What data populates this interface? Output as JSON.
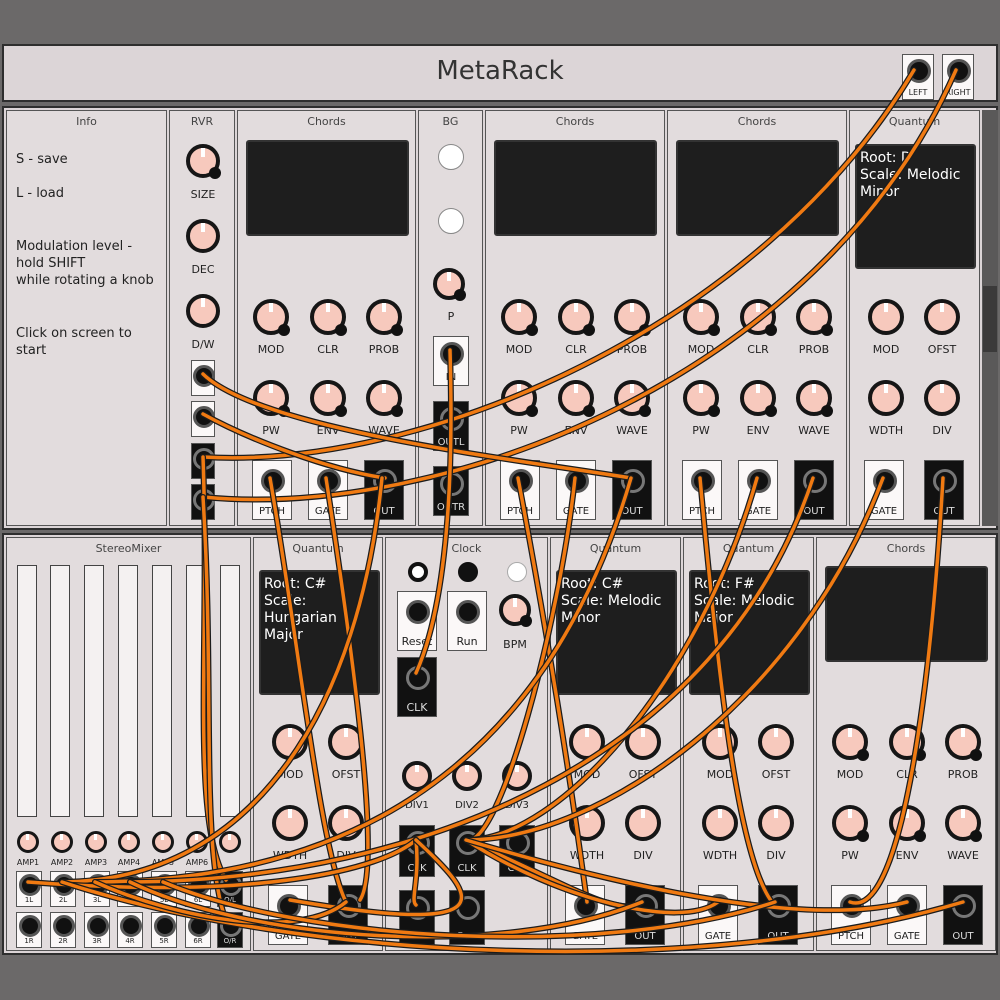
{
  "app": {
    "title": "MetaRack"
  },
  "header": {
    "left_label": "LEFT",
    "right_label": "RIGHT"
  },
  "colors": {
    "cable": "#f07a12",
    "knob": "#f7c9bd",
    "panel": "#e2dcdd",
    "screen": "#1e1e1e"
  },
  "info": {
    "title": "Info",
    "line1": "S - save",
    "line2": "L - load",
    "line3": "Modulation level -\nhold SHIFT\nwhile rotating a knob",
    "line4": "Click on screen to start"
  },
  "rvr": {
    "title": "RVR",
    "size": "SIZE",
    "dec": "DEC",
    "dw": "D/W"
  },
  "bg": {
    "title": "BG",
    "p": "P",
    "in": "IN",
    "outl": "OUTL",
    "outr": "OUTR"
  },
  "chords": {
    "title": "Chords",
    "mod": "MOD",
    "clr": "CLR",
    "prob": "PROB",
    "pw": "PW",
    "env": "ENV",
    "wave": "WAVE",
    "ptch": "PTCH",
    "gate": "GATE",
    "out": "OUT"
  },
  "quantum": {
    "title": "Quantum",
    "mod": "MOD",
    "ofst": "OFST",
    "wdth": "WDTH",
    "div": "DIV",
    "gate": "GATE",
    "out": "OUT"
  },
  "quantum1": {
    "screen": "Root: D\nScale: Melodic\nMinor"
  },
  "quantum2": {
    "screen": "Root: C#\nScale: Hungarian\nMajor"
  },
  "quantum3": {
    "screen": "Root: C#\nScale: Melodic\nMinor"
  },
  "quantum4": {
    "screen": "Root: F#\nScale: Melodic\nMajor"
  },
  "clock": {
    "title": "Clock",
    "reset": "Reset",
    "run": "Run",
    "bpm": "BPM",
    "clk": "CLK",
    "div1": "DIV1",
    "div2": "DIV2",
    "div3": "DIV3"
  },
  "mixer": {
    "title": "StereoMixer",
    "amps": [
      "AMP1",
      "AMP2",
      "AMP3",
      "AMP4",
      "AMP5",
      "AMP6"
    ],
    "left_inputs": [
      "1L",
      "2L",
      "3L",
      "4L",
      "5L",
      "6L"
    ],
    "right_inputs": [
      "1R",
      "2R",
      "3R",
      "4R",
      "5R",
      "6R"
    ],
    "out_l": "O/L",
    "out_r": "O/R"
  }
}
